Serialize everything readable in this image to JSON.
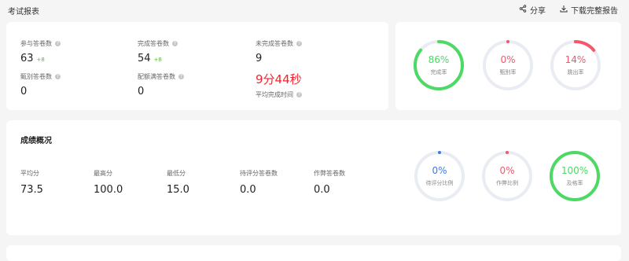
{
  "header": {
    "title": "考试报表",
    "share_label": "分享",
    "download_label": "下载完整报告"
  },
  "overview": {
    "participants": {
      "label": "参与答卷数",
      "value": "63",
      "delta": "+8"
    },
    "completed": {
      "label": "完成答卷数",
      "value": "54",
      "delta": "+8"
    },
    "incomplete": {
      "label": "未完成答卷数",
      "value": "9"
    },
    "screened": {
      "label": "甄别答卷数",
      "value": "0"
    },
    "quota_full": {
      "label": "配额满答卷数",
      "value": "0"
    },
    "avg_time": {
      "value": "9分44秒",
      "label": "平均完成时间"
    }
  },
  "rates": [
    {
      "percent": "86%",
      "label": "完成率",
      "fill": 0.86,
      "color": "#4cd964",
      "text_color": "#4cd964"
    },
    {
      "percent": "0%",
      "label": "甄别率",
      "fill": 0,
      "color": "#f5576c",
      "text_color": "#f5576c"
    },
    {
      "percent": "14%",
      "label": "跳出率",
      "fill": 0.14,
      "color": "#f5576c",
      "text_color": "#f5576c"
    }
  ],
  "scores": {
    "title": "成绩概况",
    "stats": [
      {
        "label": "平均分",
        "value": "73.5"
      },
      {
        "label": "最高分",
        "value": "100.0"
      },
      {
        "label": "最低分",
        "value": "15.0"
      },
      {
        "label": "待评分答卷数",
        "value": "0.0"
      },
      {
        "label": "作弊答卷数",
        "value": "0.0"
      }
    ],
    "rings": [
      {
        "percent": "0%",
        "label": "待评分比例",
        "fill": 0,
        "color": "#3a7be8",
        "text_color": "#3a7be8"
      },
      {
        "percent": "0%",
        "label": "作弊比例",
        "fill": 0,
        "color": "#f5576c",
        "text_color": "#f5576c"
      },
      {
        "percent": "100%",
        "label": "及格率",
        "fill": 1.0,
        "color": "#4cd964",
        "text_color": "#4cd964"
      }
    ]
  }
}
